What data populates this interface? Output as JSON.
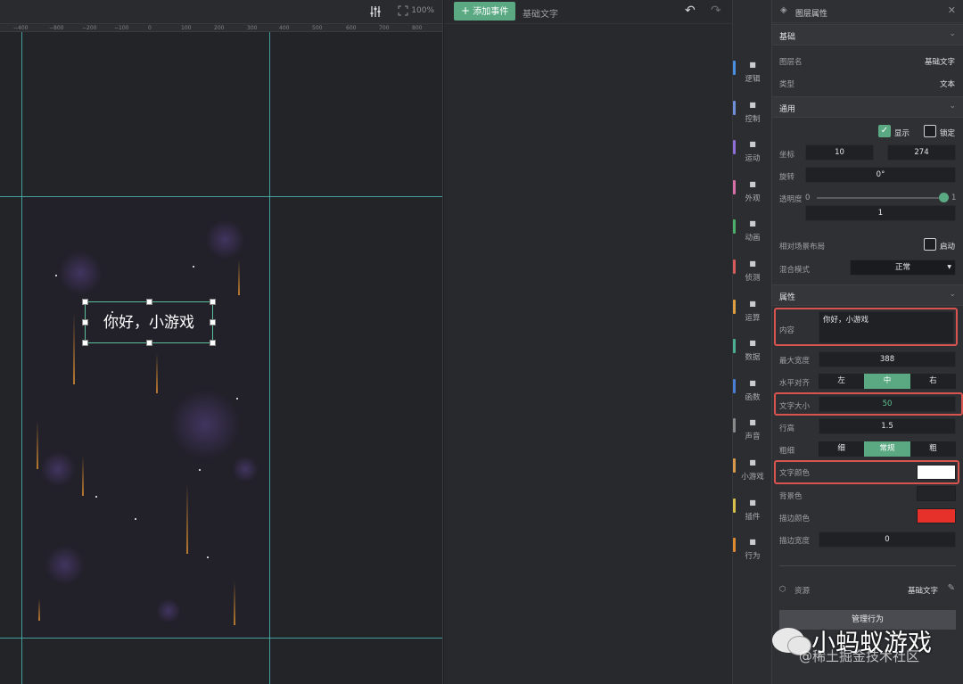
{
  "canvas": {
    "zoom": "100%",
    "ruler_labels": [
      "−400",
      "−800",
      "−200",
      "−100",
      "0",
      "100",
      "200",
      "300",
      "400",
      "500",
      "600",
      "700",
      "800"
    ],
    "text_element": "你好，小游戏"
  },
  "middle": {
    "add_event_label": "添加事件",
    "breadcrumb": "基础文字"
  },
  "rail": {
    "items": [
      {
        "label": "逻辑",
        "color": "#4a90e2",
        "icon": "sitemap-icon"
      },
      {
        "label": "控制",
        "color": "#6f8fd8",
        "icon": "gamepad-icon"
      },
      {
        "label": "运动",
        "color": "#8e6fd8",
        "icon": "running-icon"
      },
      {
        "label": "外观",
        "color": "#d86fa8",
        "icon": "shirt-icon"
      },
      {
        "label": "动画",
        "color": "#4caf6a",
        "icon": "film-icon"
      },
      {
        "label": "侦测",
        "color": "#d85a5a",
        "icon": "signal-icon"
      },
      {
        "label": "运算",
        "color": "#e0a040",
        "icon": "calculator-icon"
      },
      {
        "label": "数据",
        "color": "#4caf8f",
        "icon": "database-icon"
      },
      {
        "label": "函数",
        "color": "#4a7fd8",
        "icon": "function-icon"
      },
      {
        "label": "声音",
        "color": "#8a8a8a",
        "icon": "microphone-icon"
      },
      {
        "label": "小游戏",
        "color": "#d89a4a",
        "icon": "puzzle-icon"
      },
      {
        "label": "插件",
        "color": "#d8c04a",
        "icon": "plugin-icon"
      },
      {
        "label": "行为",
        "color": "#e08a30",
        "icon": "behavior-icon"
      }
    ]
  },
  "props": {
    "title": "图层属性",
    "sec_basic": "基础",
    "layer_name_label": "图层名",
    "layer_name": "基础文字",
    "type_label": "类型",
    "type": "文本",
    "sec_general": "通用",
    "show_label": "显示",
    "lock_label": "锁定",
    "coord_label": "坐标",
    "coord_x": "10",
    "coord_y": "274",
    "rotate_label": "旋转",
    "rotate": "0°",
    "opacity_label": "透明度",
    "opacity_min": "0",
    "opacity_max": "1",
    "opacity": "1",
    "opacity_value": 1,
    "relative_label": "相对场景布局",
    "relative_check": "启动",
    "blend_label": "混合模式",
    "blend": "正常",
    "sec_attr": "属性",
    "content_label": "内容",
    "content": "你好，小游戏",
    "maxwidth_label": "最大宽度",
    "maxwidth": "388",
    "halign_label": "水平对齐",
    "halign_opts": [
      "左",
      "中",
      "右"
    ],
    "fontsize_label": "文字大小",
    "fontsize": "50",
    "lineheight_label": "行高",
    "lineheight": "1.5",
    "weight_label": "粗细",
    "weight_opts": [
      "细",
      "常规",
      "粗"
    ],
    "color_label": "文字颜色",
    "color": "#ffffff",
    "bg_label": "背景色",
    "bg": "#232428",
    "stroke_color_label": "描边颜色",
    "stroke_color": "#e5312a",
    "stroke_width_label": "描边宽度",
    "stroke_width": "0",
    "resource_label": "资源",
    "resource": "基础文字",
    "manage_label": "管理行为"
  },
  "watermark": {
    "brand": "小蚂蚁游戏",
    "sub": "@稀土掘金技术社区"
  }
}
